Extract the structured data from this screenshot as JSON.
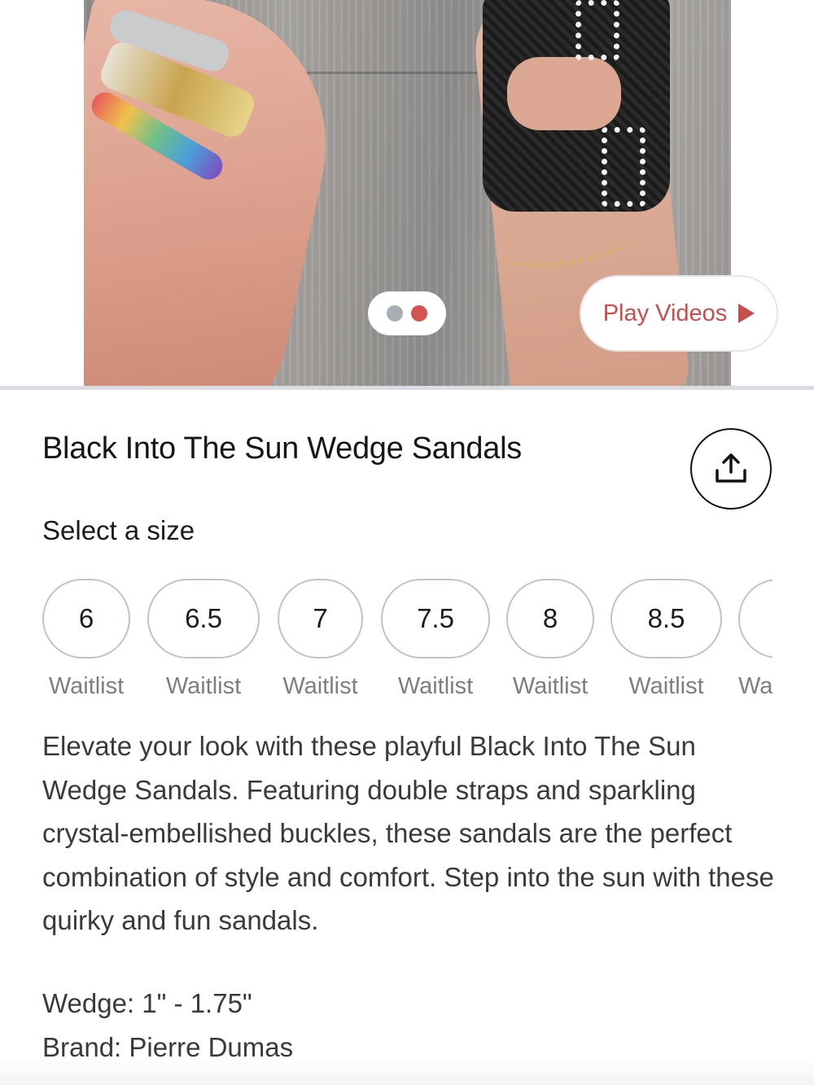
{
  "gallery": {
    "image_alt": "Black Into The Sun Wedge Sandals product photo",
    "dots": [
      {
        "active": false,
        "color": "#a9aeb4"
      },
      {
        "active": true,
        "color": "#d6544f"
      }
    ],
    "play_videos_label": "Play Videos",
    "accent_color": "#c94d4d"
  },
  "product": {
    "title": "Black Into The Sun Wedge Sandals",
    "share_icon": "share-icon",
    "size_heading": "Select a size",
    "sizes": [
      {
        "label": "6",
        "status": "Waitlist"
      },
      {
        "label": "6.5",
        "status": "Waitlist"
      },
      {
        "label": "7",
        "status": "Waitlist"
      },
      {
        "label": "7.5",
        "status": "Waitlist"
      },
      {
        "label": "8",
        "status": "Waitlist"
      },
      {
        "label": "8.5",
        "status": "Waitlist"
      },
      {
        "label": "",
        "status": "Waitlist"
      }
    ],
    "description": "Elevate your look with these playful Black Into The Sun Wedge Sandals. Featuring double straps and sparkling crystal-embellished buckles, these sandals are the perfect combination of style and comfort. Step into the sun with these quirky and fun sandals.",
    "specs": [
      "Wedge: 1\" - 1.75\"",
      "Brand: Pierre Dumas"
    ]
  }
}
